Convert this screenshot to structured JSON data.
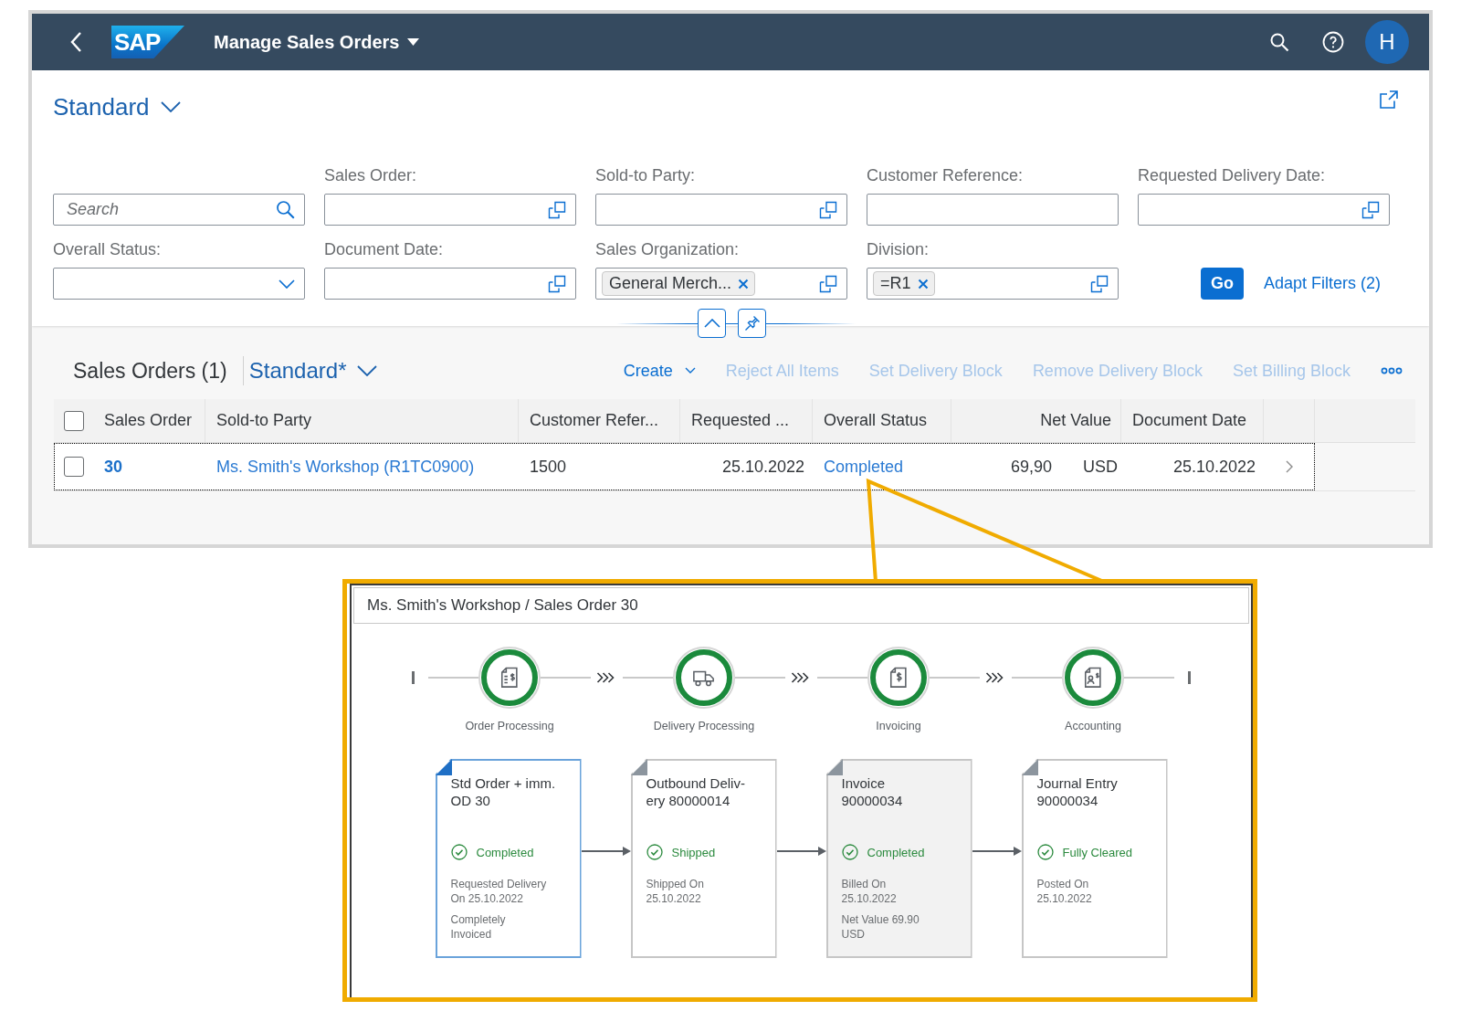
{
  "shell_bar": {
    "logo": "SAP",
    "title": "Manage Sales Orders",
    "avatar": "H"
  },
  "page_variant": {
    "title": "Standard"
  },
  "filter_bar": {
    "fields": [
      {
        "kind": "search",
        "placeholder": "Search"
      },
      {
        "kind": "value_help",
        "label": "Sales Order:"
      },
      {
        "kind": "value_help",
        "label": "Sold-to Party:"
      },
      {
        "kind": "text",
        "label": "Customer Reference:"
      },
      {
        "kind": "value_help",
        "label": "Requested Delivery Date:"
      },
      {
        "kind": "select",
        "label": "Overall Status:"
      },
      {
        "kind": "value_help",
        "label": "Document Date:"
      },
      {
        "kind": "value_help",
        "label": "Sales Organization:",
        "tokens": [
          "General Merch..."
        ]
      },
      {
        "kind": "value_help",
        "label": "Division:",
        "tokens": [
          "=R1"
        ]
      }
    ],
    "go_button": "Go",
    "adapt_filters": "Adapt Filters (2)"
  },
  "table": {
    "title": "Sales Orders (1)",
    "variant": "Standard*",
    "actions": [
      {
        "label": "Create",
        "disabled": false,
        "menu": true
      },
      {
        "label": "Reject All Items",
        "disabled": true,
        "menu": false
      },
      {
        "label": "Set Delivery Block",
        "disabled": true,
        "menu": false
      },
      {
        "label": "Remove Delivery Block",
        "disabled": true,
        "menu": false
      },
      {
        "label": "Set Billing Block",
        "disabled": true,
        "menu": false
      }
    ],
    "select_all": {
      "checked": false
    },
    "columns": [
      "Sales Order",
      "Sold-to Party",
      "Customer Refer...",
      "Requested ...",
      "Overall Status",
      "Net Value",
      "Document Date"
    ],
    "rows": [
      {
        "selected": false,
        "focused": true,
        "sales_order": "30",
        "sold_to_party": "Ms. Smith's Workshop (R1TC0900)",
        "customer_reference": "1500",
        "requested": "25.10.2022",
        "overall_status": "Completed",
        "net_value": "69,90",
        "currency": "USD",
        "document_date": "25.10.2022"
      }
    ]
  },
  "process_flow": {
    "title": "Ms. Smith's Workshop / Sales Order 30",
    "lanes": [
      {
        "kind": "order",
        "label": "Order Processing",
        "done": true
      },
      {
        "kind": "delivery",
        "label": "Delivery Processing",
        "done": true
      },
      {
        "kind": "invoice",
        "label": "Invoicing",
        "done": true
      },
      {
        "kind": "accounting",
        "label": "Accounting",
        "done": true
      }
    ],
    "nodes": [
      {
        "title_lines": [
          "Std Order + imm.",
          "OD 30"
        ],
        "status": "Completed",
        "done": true,
        "details": [
          [
            "Requested Delivery",
            "On 25.10.2022"
          ],
          [
            "Completely",
            "Invoiced"
          ]
        ],
        "selected": true,
        "hovered": false
      },
      {
        "title_lines": [
          "Outbound Deliv-",
          "ery 80000014"
        ],
        "status": "Shipped",
        "done": true,
        "details": [
          [
            "Shipped On",
            "25.10.2022"
          ]
        ],
        "selected": false,
        "hovered": false
      },
      {
        "title_lines": [
          "Invoice",
          "90000034"
        ],
        "status": "Completed",
        "done": true,
        "details": [
          [
            "Billed On",
            "25.10.2022"
          ],
          [
            "Net Value 69.90",
            "USD"
          ]
        ],
        "selected": false,
        "hovered": true
      },
      {
        "title_lines": [
          "Journal Entry",
          "90000034"
        ],
        "status": "Fully Cleared",
        "done": true,
        "details": [
          [
            "Posted On",
            "25.10.2022"
          ]
        ],
        "selected": false,
        "hovered": false
      }
    ]
  }
}
